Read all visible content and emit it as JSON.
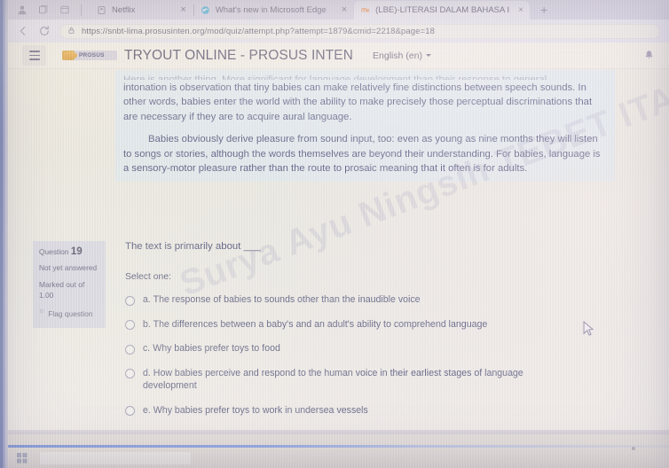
{
  "browser": {
    "system_icons": [
      "profile-icon",
      "collections-icon",
      "split-screen-icon"
    ],
    "tabs": [
      {
        "title": "Netflix",
        "favicon": "netflix-icon",
        "active": false,
        "close_label": "×"
      },
      {
        "title": "What's new in Microsoft Edge",
        "favicon": "edge-icon",
        "active": false,
        "close_label": "×"
      },
      {
        "title": "(LBE)-LITERASI DALAM BAHASA I",
        "favicon": "moodle-icon",
        "active": true,
        "close_label": "×"
      }
    ],
    "new_tab_label": "+",
    "back_label": "←",
    "reload_label": "⟳",
    "url": "https://snbt-lima.prosusinten.org/mod/quiz/attempt.php?attempt=1879&cmid=2218&page=18",
    "lock_icon": "lock-icon"
  },
  "navbar": {
    "menu_label": "☰",
    "logo_text": "PROSUS INTEN",
    "site_name": "TRYOUT ONLINE - PROSUS INTEN",
    "language": "English (en)",
    "notification_icon": "bell-icon"
  },
  "passage": {
    "clipped_line": "Here is another thing. More significant for language development than their response to general",
    "paragraphs": [
      "intonation is observation that tiny babies can make relatively fine distinctions between speech sounds. In other words, babies enter the world with the ability to make precisely those perceptual discriminations that are necessary if they are to acquire aural language.",
      "Babies obviously derive pleasure from sound input, too: even as young as nine months they will listen to songs or stories, although the words themselves are beyond their understanding. For babies, language is a sensory-motor pleasure rather than the route to prosaic meaning that it often is for adults."
    ]
  },
  "question": {
    "number_label": "Question",
    "number": "19",
    "state": "Not yet answered",
    "marked_out_of": "Marked out of 1.00",
    "flag_label": "Flag question",
    "flag_icon": "flag-icon",
    "text": "The text is primarily about ___",
    "select_one": "Select one:",
    "options": [
      {
        "key": "a.",
        "text": "The response of babies to sounds other than the inaudible voice",
        "selected": false
      },
      {
        "key": "b.",
        "text": "The differences between a baby's and an adult's ability to comprehend language",
        "selected": false
      },
      {
        "key": "c.",
        "text": "Why babies prefer toys to food",
        "selected": false
      },
      {
        "key": "d.",
        "text": "How babies perceive and respond to the human voice in their earliest stages of language development",
        "selected": false
      },
      {
        "key": "e.",
        "text": "Why babies prefer toys to work in undersea vessels",
        "selected": false
      }
    ]
  },
  "watermark": {
    "text": "Surya Ayu Ningsih TEBET ITA"
  },
  "colors": {
    "passage_bg": "#dfe8ec",
    "question_info_bg": "#d4d4e1",
    "text": "#3b3f68",
    "brand_orange": "#e09a22",
    "page_bg": "#efeadd"
  }
}
